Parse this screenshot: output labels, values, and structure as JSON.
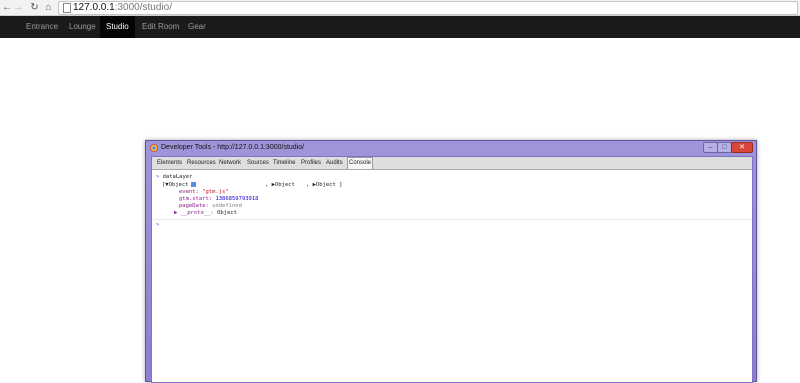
{
  "browser": {
    "back_icon": "left-arrow-icon",
    "forward_icon": "right-arrow-icon",
    "reload_icon": "reload-icon",
    "home_icon": "home-icon",
    "page_icon": "page-icon",
    "url_host": "127.0.0.1",
    "url_rest": ":3000/studio/"
  },
  "nav": {
    "items": [
      {
        "label": "Entrance"
      },
      {
        "label": "Lounge"
      },
      {
        "label": "Studio"
      },
      {
        "label": "Edit Room"
      },
      {
        "label": "Gear"
      }
    ]
  },
  "devtools": {
    "title": "Developer Tools - http://127.0.0.1:3000/studio/",
    "tabs": [
      {
        "label": "Elements"
      },
      {
        "label": "Resources"
      },
      {
        "label": "Network"
      },
      {
        "label": "Sources"
      },
      {
        "label": "Timeline"
      },
      {
        "label": "Profiles"
      },
      {
        "label": "Audits"
      },
      {
        "label": "Console"
      }
    ],
    "console": {
      "command": "dataLayer",
      "array_open": "[▼Object",
      "array_rest1": ", ▶Object",
      "array_rest2": ", ▶Object ]",
      "event_key": "event:",
      "event_val": "\"gtm.js\"",
      "start_key": "gtm.start:",
      "start_val": "1386859793918",
      "pagedate_key": "pageDate:",
      "pagedate_val": "undefined",
      "proto_key": "▶ __proto__:",
      "proto_val": "Object",
      "prompt": ">"
    }
  }
}
